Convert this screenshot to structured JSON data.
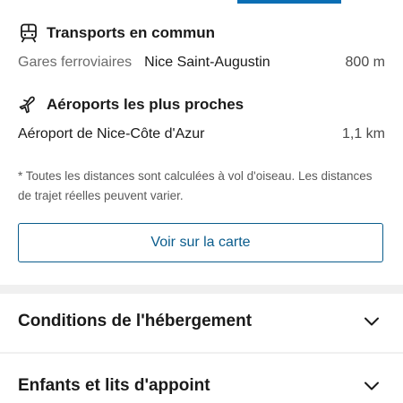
{
  "transports": {
    "heading": "Transports en commun",
    "icon": "train-icon",
    "items": [
      {
        "category": "Gares ferroviaires",
        "name": "Nice Saint-Augustin",
        "distance": "800 m"
      }
    ]
  },
  "airports": {
    "heading": "Aéroports les plus proches",
    "icon": "airplane-icon",
    "items": [
      {
        "name": "Aéroport de Nice-Côte d'Azur",
        "distance": "1,1 km"
      }
    ]
  },
  "note": "* Toutes les distances sont calculées à vol d'oiseau. Les distances de trajet réelles peuvent varier.",
  "map_button": {
    "label": "Voir sur la carte"
  },
  "accordions": [
    {
      "title": "Conditions de l'hébergement",
      "icon": "chevron-down-icon"
    },
    {
      "title": "Enfants et lits d'appoint",
      "icon": "chevron-down-icon"
    }
  ],
  "colors": {
    "accent": "#0a6eb4",
    "button_text": "#0a5c8c",
    "separator": "#f0f0f0"
  }
}
